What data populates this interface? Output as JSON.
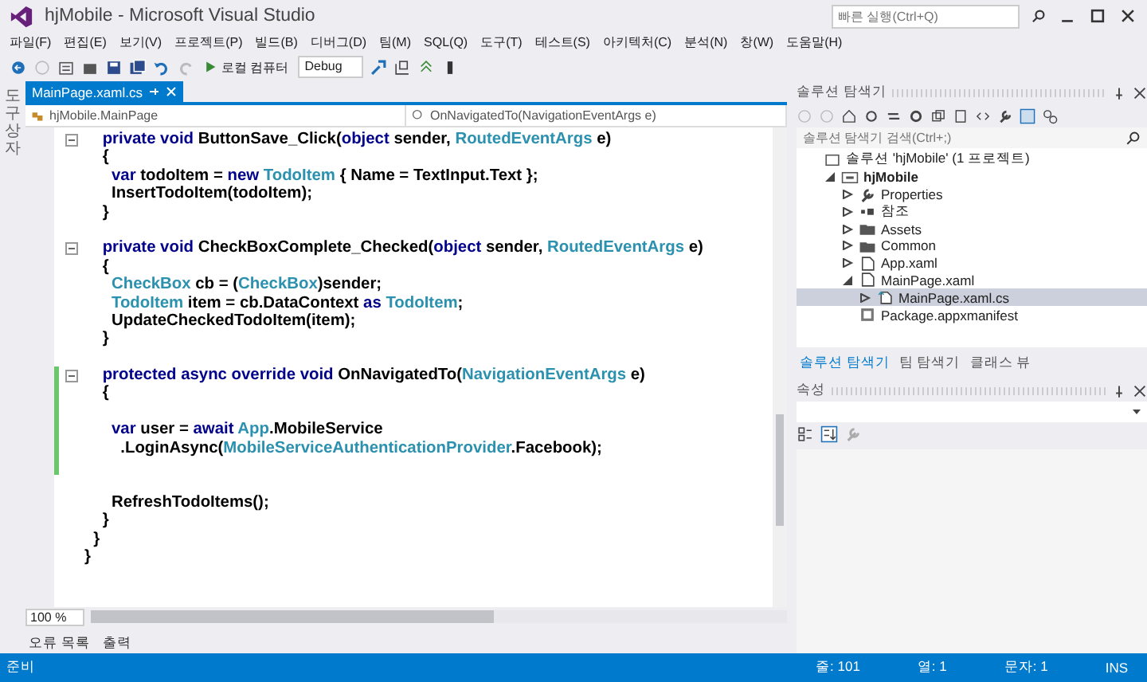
{
  "window": {
    "title": "hjMobile - Microsoft Visual Studio",
    "quick_launch": {
      "placeholder": "빠른 실행(Ctrl+Q)"
    }
  },
  "menu": [
    "파일(F)",
    "편집(E)",
    "보기(V)",
    "프로젝트(P)",
    "빌드(B)",
    "디버그(D)",
    "팀(M)",
    "SQL(Q)",
    "도구(T)",
    "테스트(S)",
    "아키텍처(C)",
    "분석(N)",
    "창(W)",
    "도움말(H)"
  ],
  "toolbar": {
    "run_target": "로컬 컴퓨터",
    "configuration": "Debug"
  },
  "toolbox_strip": {
    "label": "도구 상자"
  },
  "document_tabs": [
    {
      "label": "MainPage.xaml.cs",
      "selected": true
    }
  ],
  "navigation_bar": {
    "type": "hjMobile.MainPage",
    "member": "OnNavigatedTo(NavigationEventArgs e)"
  },
  "code_lines": [
    {
      "foldable": true,
      "changed": false,
      "tokens": [
        {
          "text": "    private void",
          "kind": "keyword"
        },
        {
          "text": " ButtonSave_Click(",
          "kind": "plain"
        },
        {
          "text": "object",
          "kind": "keyword"
        },
        {
          "text": " sender, ",
          "kind": "plain"
        },
        {
          "text": "RoutedEventArgs",
          "kind": "type"
        },
        {
          "text": " e)",
          "kind": "plain"
        }
      ]
    },
    {
      "foldable": false,
      "changed": false,
      "tokens": [
        {
          "text": "    {",
          "kind": "plain"
        }
      ]
    },
    {
      "foldable": false,
      "changed": false,
      "tokens": [
        {
          "text": "      var",
          "kind": "keyword"
        },
        {
          "text": " todoItem = ",
          "kind": "plain"
        },
        {
          "text": "new",
          "kind": "keyword"
        },
        {
          "text": " TodoItem",
          "kind": "type"
        },
        {
          "text": " { Name = TextInput.Text };",
          "kind": "plain"
        }
      ]
    },
    {
      "foldable": false,
      "changed": false,
      "tokens": [
        {
          "text": "      InsertTodoItem(todoItem);",
          "kind": "plain"
        }
      ]
    },
    {
      "foldable": false,
      "changed": false,
      "tokens": [
        {
          "text": "    }",
          "kind": "plain"
        }
      ]
    },
    {
      "foldable": false,
      "changed": false
    },
    {
      "foldable": true,
      "changed": false,
      "tokens": [
        {
          "text": "    private void",
          "kind": "keyword"
        },
        {
          "text": " CheckBoxComplete_Checked(",
          "kind": "plain"
        },
        {
          "text": "object",
          "kind": "keyword"
        },
        {
          "text": " sender, ",
          "kind": "plain"
        },
        {
          "text": "RoutedEventArgs",
          "kind": "type"
        },
        {
          "text": " e)",
          "kind": "plain"
        }
      ]
    },
    {
      "foldable": false,
      "changed": false,
      "tokens": [
        {
          "text": "    {",
          "kind": "plain"
        }
      ]
    },
    {
      "foldable": false,
      "changed": false,
      "tokens": [
        {
          "text": "      CheckBox",
          "kind": "type"
        },
        {
          "text": " cb = (",
          "kind": "plain"
        },
        {
          "text": "CheckBox",
          "kind": "type"
        },
        {
          "text": ")sender;",
          "kind": "plain"
        }
      ]
    },
    {
      "foldable": false,
      "changed": false,
      "tokens": [
        {
          "text": "      TodoItem",
          "kind": "type"
        },
        {
          "text": " item = cb.DataContext ",
          "kind": "plain"
        },
        {
          "text": "as",
          "kind": "keyword"
        },
        {
          "text": " TodoItem",
          "kind": "type"
        },
        {
          "text": ";",
          "kind": "plain"
        }
      ]
    },
    {
      "foldable": false,
      "changed": false,
      "tokens": [
        {
          "text": "      UpdateCheckedTodoItem(item);",
          "kind": "plain"
        }
      ]
    },
    {
      "foldable": false,
      "changed": false,
      "tokens": [
        {
          "text": "    }",
          "kind": "plain"
        }
      ]
    },
    {
      "foldable": false,
      "changed": false
    },
    {
      "foldable": true,
      "changed": true,
      "tokens": [
        {
          "text": "    protected async override void",
          "kind": "keyword"
        },
        {
          "text": " OnNavigatedTo(",
          "kind": "plain"
        },
        {
          "text": "NavigationEventArgs",
          "kind": "type"
        },
        {
          "text": " e)",
          "kind": "plain"
        }
      ]
    },
    {
      "foldable": false,
      "changed": true,
      "tokens": [
        {
          "text": "    {",
          "kind": "plain"
        }
      ]
    },
    {
      "foldable": false,
      "changed": true
    },
    {
      "foldable": false,
      "changed": true,
      "tokens": [
        {
          "text": "      var",
          "kind": "keyword"
        },
        {
          "text": " user = ",
          "kind": "plain"
        },
        {
          "text": "await",
          "kind": "keyword"
        },
        {
          "text": " App",
          "kind": "type"
        },
        {
          "text": ".MobileService",
          "kind": "plain"
        }
      ]
    },
    {
      "foldable": false,
      "changed": true,
      "tokens": [
        {
          "text": "        .LoginAsync(",
          "kind": "plain"
        },
        {
          "text": "MobileServiceAuthenticationProvider",
          "kind": "type"
        },
        {
          "text": ".Facebook);",
          "kind": "plain"
        }
      ]
    },
    {
      "foldable": false,
      "changed": true
    },
    {
      "foldable": false,
      "changed": false
    },
    {
      "foldable": false,
      "changed": false,
      "tokens": [
        {
          "text": "      RefreshTodoItems();",
          "kind": "plain"
        }
      ]
    },
    {
      "foldable": false,
      "changed": false,
      "tokens": [
        {
          "text": "    }",
          "kind": "plain"
        }
      ]
    },
    {
      "foldable": false,
      "changed": false,
      "tokens": [
        {
          "text": "  }",
          "kind": "plain"
        }
      ]
    },
    {
      "foldable": false,
      "changed": false,
      "tokens": [
        {
          "text": "}",
          "kind": "plain"
        }
      ]
    }
  ],
  "zoom": "100 %",
  "bottom_tabs": [
    "오류 목록",
    "출력"
  ],
  "solution_explorer": {
    "title": "솔루션 탐색기",
    "search": {
      "placeholder": "솔루션 탐색기 검색(Ctrl+;)"
    },
    "tree": [
      {
        "label": "솔루션 'hjMobile' (1 프로젝트)",
        "kind": "solution",
        "selected": false,
        "children": [
          {
            "label": "hjMobile",
            "kind": "project",
            "expanded": true,
            "selected": false,
            "children": [
              {
                "label": "Properties",
                "kind": "wrench",
                "expanded": false,
                "selected": false
              },
              {
                "label": "참조",
                "kind": "references",
                "expanded": false,
                "selected": false
              },
              {
                "label": "Assets",
                "kind": "folder",
                "expanded": false,
                "selected": false
              },
              {
                "label": "Common",
                "kind": "folder",
                "expanded": false,
                "selected": false
              },
              {
                "label": "App.xaml",
                "kind": "file",
                "expanded": false,
                "selected": false
              },
              {
                "label": "MainPage.xaml",
                "kind": "file",
                "expanded": true,
                "selected": false,
                "children": [
                  {
                    "label": "MainPage.xaml.cs",
                    "kind": "csfile",
                    "expanded": false,
                    "selected": true
                  }
                ]
              },
              {
                "label": "Package.appxmanifest",
                "kind": "manifest",
                "selected": false
              }
            ]
          }
        ]
      }
    ],
    "tabs": [
      {
        "label": "솔루션 탐색기",
        "selected": true
      },
      {
        "label": "팀 탐색기",
        "selected": false
      },
      {
        "label": "클래스 뷰",
        "selected": false
      }
    ]
  },
  "properties": {
    "title": "속성"
  },
  "status_bar": {
    "state": "준비",
    "line": "줄: 101",
    "column": "열: 1",
    "char": "문자: 1",
    "mode": "INS"
  }
}
